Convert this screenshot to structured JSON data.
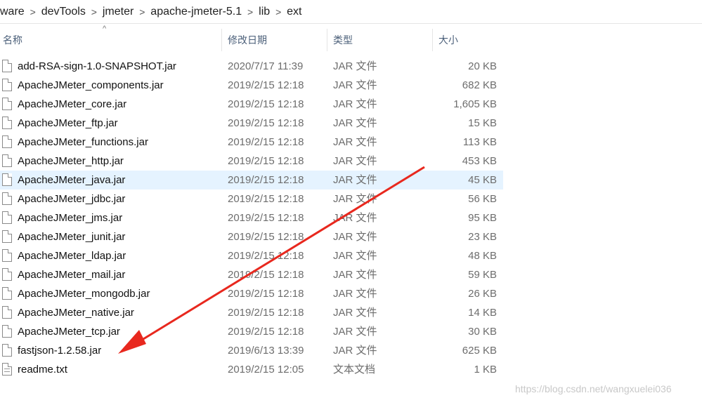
{
  "breadcrumb": [
    "ware",
    "devTools",
    "jmeter",
    "apache-jmeter-5.1",
    "lib",
    "ext"
  ],
  "breadcrumb_separator": ">",
  "columns": {
    "name": "名称",
    "date": "修改日期",
    "type": "类型",
    "size": "大小"
  },
  "sort_indicator": "^",
  "files": [
    {
      "name": "add-RSA-sign-1.0-SNAPSHOT.jar",
      "date": "2020/7/17 11:39",
      "type": "JAR 文件",
      "size": "20 KB",
      "icon": "jar-file-icon"
    },
    {
      "name": "ApacheJMeter_components.jar",
      "date": "2019/2/15 12:18",
      "type": "JAR 文件",
      "size": "682 KB",
      "icon": "jar-file-icon"
    },
    {
      "name": "ApacheJMeter_core.jar",
      "date": "2019/2/15 12:18",
      "type": "JAR 文件",
      "size": "1,605 KB",
      "icon": "jar-file-icon"
    },
    {
      "name": "ApacheJMeter_ftp.jar",
      "date": "2019/2/15 12:18",
      "type": "JAR 文件",
      "size": "15 KB",
      "icon": "jar-file-icon"
    },
    {
      "name": "ApacheJMeter_functions.jar",
      "date": "2019/2/15 12:18",
      "type": "JAR 文件",
      "size": "113 KB",
      "icon": "jar-file-icon"
    },
    {
      "name": "ApacheJMeter_http.jar",
      "date": "2019/2/15 12:18",
      "type": "JAR 文件",
      "size": "453 KB",
      "icon": "jar-file-icon"
    },
    {
      "name": "ApacheJMeter_java.jar",
      "date": "2019/2/15 12:18",
      "type": "JAR 文件",
      "size": "45 KB",
      "icon": "jar-file-icon",
      "selected": true
    },
    {
      "name": "ApacheJMeter_jdbc.jar",
      "date": "2019/2/15 12:18",
      "type": "JAR 文件",
      "size": "56 KB",
      "icon": "jar-file-icon"
    },
    {
      "name": "ApacheJMeter_jms.jar",
      "date": "2019/2/15 12:18",
      "type": "JAR 文件",
      "size": "95 KB",
      "icon": "jar-file-icon"
    },
    {
      "name": "ApacheJMeter_junit.jar",
      "date": "2019/2/15 12:18",
      "type": "JAR 文件",
      "size": "23 KB",
      "icon": "jar-file-icon"
    },
    {
      "name": "ApacheJMeter_ldap.jar",
      "date": "2019/2/15 12:18",
      "type": "JAR 文件",
      "size": "48 KB",
      "icon": "jar-file-icon"
    },
    {
      "name": "ApacheJMeter_mail.jar",
      "date": "2019/2/15 12:18",
      "type": "JAR 文件",
      "size": "59 KB",
      "icon": "jar-file-icon"
    },
    {
      "name": "ApacheJMeter_mongodb.jar",
      "date": "2019/2/15 12:18",
      "type": "JAR 文件",
      "size": "26 KB",
      "icon": "jar-file-icon"
    },
    {
      "name": "ApacheJMeter_native.jar",
      "date": "2019/2/15 12:18",
      "type": "JAR 文件",
      "size": "14 KB",
      "icon": "jar-file-icon"
    },
    {
      "name": "ApacheJMeter_tcp.jar",
      "date": "2019/2/15 12:18",
      "type": "JAR 文件",
      "size": "30 KB",
      "icon": "jar-file-icon"
    },
    {
      "name": "fastjson-1.2.58.jar",
      "date": "2019/6/13 13:39",
      "type": "JAR 文件",
      "size": "625 KB",
      "icon": "jar-file-icon"
    },
    {
      "name": "readme.txt",
      "date": "2019/2/15 12:05",
      "type": "文本文档",
      "size": "1 KB",
      "icon": "text-file-icon"
    }
  ],
  "watermark": "https://blog.csdn.net/wangxuelei036",
  "colors": {
    "selection": "#e5f3ff",
    "header_text": "#4c607a",
    "arrow": "#e8281e"
  }
}
